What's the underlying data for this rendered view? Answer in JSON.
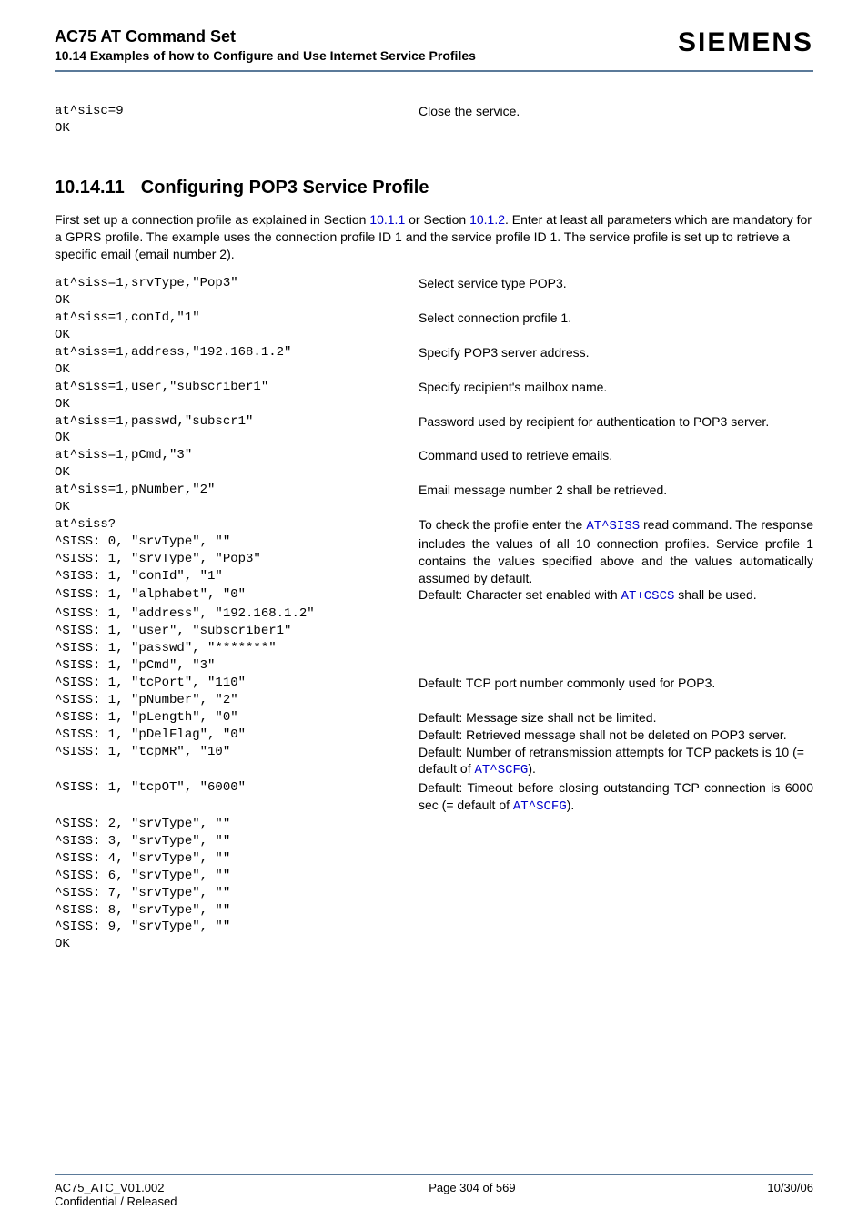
{
  "header": {
    "doc_title": "AC75 AT Command Set",
    "doc_subtitle": "10.14 Examples of how to Configure and Use Internet Service Profiles",
    "brand": "SIEMENS"
  },
  "top_block": {
    "code1": "at^sisc=9",
    "code2": "OK",
    "desc1": "Close the service."
  },
  "section": {
    "number": "10.14.11",
    "title": "Configuring POP3 Service Profile",
    "intro_pre": "First set up a connection profile as explained in Section ",
    "link1": "10.1.1",
    "intro_mid": " or Section ",
    "link2": "10.1.2",
    "intro_post": ". Enter at least all parameters which are mandatory for a GPRS profile. The example uses the connection profile ID 1 and the service profile ID 1. The service profile is set up to retrieve a specific email (email number 2)."
  },
  "rows": [
    {
      "code": "at^siss=1,srvType,\"Pop3\"",
      "desc": "Select service type POP3."
    },
    {
      "code": "OK",
      "desc": ""
    },
    {
      "code": "at^siss=1,conId,\"1\"",
      "desc": "Select connection profile 1."
    },
    {
      "code": "OK",
      "desc": ""
    },
    {
      "code": "at^siss=1,address,\"192.168.1.2\"",
      "desc": "Specify POP3 server address."
    },
    {
      "code": "OK",
      "desc": ""
    },
    {
      "code": "at^siss=1,user,\"subscriber1\"",
      "desc": "Specify recipient's mailbox name."
    },
    {
      "code": "OK",
      "desc": ""
    },
    {
      "code": "at^siss=1,passwd,\"subscr1\"",
      "desc": "Password used by recipient for authentication to POP3 server.",
      "justify": true,
      "span2": true
    },
    {
      "code": "OK",
      "desc": "",
      "skip_desc_row": true
    },
    {
      "code": "at^siss=1,pCmd,\"3\"",
      "desc": "Command used to retrieve emails."
    },
    {
      "code": "OK",
      "desc": ""
    },
    {
      "code": "at^siss=1,pNumber,\"2\"",
      "desc": "Email message number 2 shall be retrieved."
    },
    {
      "code": "OK",
      "desc": ""
    }
  ],
  "siss_query": {
    "code_lines": [
      "at^siss?",
      "^SISS: 0, \"srvType\", \"\"",
      "^SISS: 1, \"srvType\", \"Pop3\"",
      "^SISS: 1, \"conId\", \"1\""
    ],
    "desc_pre": "To check the profile enter the ",
    "desc_link": "AT^SISS",
    "desc_post": " read command. The response includes the values of all 10 connection profiles. Service profile 1 contains the values specified above and the values automatically assumed by default."
  },
  "alphabet_row": {
    "code": "^SISS: 1, \"alphabet\", \"0\"",
    "desc_pre": "Default: Character set enabled with ",
    "desc_link": "AT+CSCS",
    "desc_post": " shall be used."
  },
  "middle_code_lines": [
    "^SISS: 1, \"address\", \"192.168.1.2\"",
    "^SISS: 1, \"user\", \"subscriber1\"",
    "^SISS: 1, \"passwd\", \"*******\"",
    "^SISS: 1, \"pCmd\", \"3\""
  ],
  "tcport_row": {
    "code": "^SISS: 1, \"tcPort\", \"110\"",
    "desc": "Default: TCP port number commonly used for POP3."
  },
  "pnumber_row": {
    "code": "^SISS: 1, \"pNumber\", \"2\"",
    "desc": ""
  },
  "plength_row": {
    "code": "^SISS: 1, \"pLength\", \"0\"",
    "desc": "Default: Message size shall not be limited."
  },
  "pdelflag_row": {
    "code": "^SISS: 1, \"pDelFlag\", \"0\"",
    "desc": "Default: Retrieved message shall not be deleted on POP3 server."
  },
  "tcpmr_row": {
    "code": "^SISS: 1, \"tcpMR\", \"10\"",
    "desc_pre": "Default: Number of retransmission attempts for TCP packets is 10 (= default of ",
    "desc_link": "AT^SCFG",
    "desc_post": ")."
  },
  "tcpot_row": {
    "code": "^SISS: 1, \"tcpOT\", \"6000\"",
    "desc_pre": "Default: Timeout before closing outstanding TCP connection is 6000 sec (= default of ",
    "desc_link": "AT^SCFG",
    "desc_post": ")."
  },
  "trailing_code_lines": [
    "^SISS: 2, \"srvType\", \"\"",
    "^SISS: 3, \"srvType\", \"\"",
    "^SISS: 4, \"srvType\", \"\"",
    "^SISS: 6, \"srvType\", \"\"",
    "^SISS: 7, \"srvType\", \"\"",
    "^SISS: 8, \"srvType\", \"\"",
    "^SISS: 9, \"srvType\", \"\"",
    "OK"
  ],
  "footer": {
    "left1": "AC75_ATC_V01.002",
    "left2": "Confidential / Released",
    "center": "Page 304 of 569",
    "right": "10/30/06"
  }
}
